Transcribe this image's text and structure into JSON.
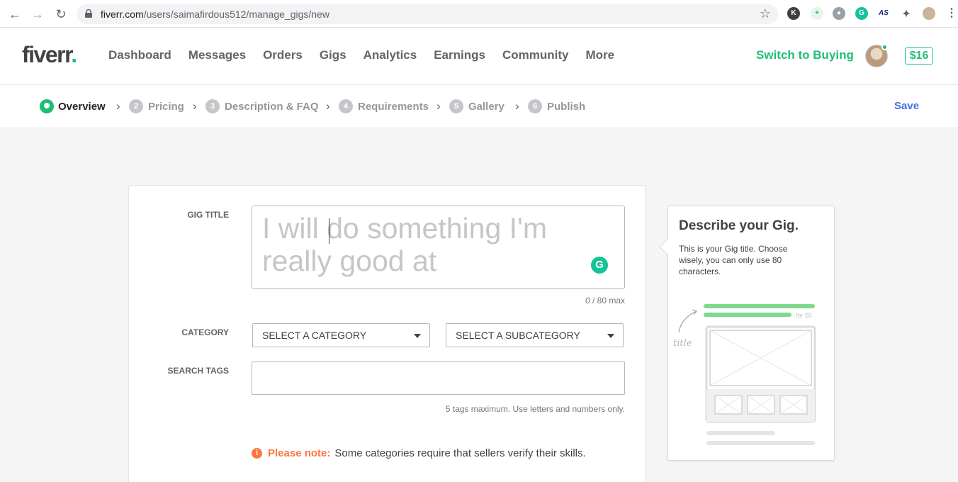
{
  "browser": {
    "url_host": "fiverr.com",
    "url_path": "/users/saimafirdous512/manage_gigs/new"
  },
  "header": {
    "logo": "fiverr",
    "logo_dot": ".",
    "nav": [
      "Dashboard",
      "Messages",
      "Orders",
      "Gigs",
      "Analytics",
      "Earnings",
      "Community",
      "More"
    ],
    "switch_label": "Switch to Buying",
    "balance": "$16"
  },
  "steps": {
    "items": [
      {
        "num": "",
        "label": "Overview"
      },
      {
        "num": "2",
        "label": "Pricing"
      },
      {
        "num": "3",
        "label": "Description & FAQ"
      },
      {
        "num": "4",
        "label": "Requirements"
      },
      {
        "num": "5",
        "label": "Gallery"
      },
      {
        "num": "6",
        "label": "Publish"
      }
    ],
    "save_label": "Save"
  },
  "form": {
    "gig_title_label": "GIG TITLE",
    "gig_title_placeholder": "I will do something I'm really good at",
    "gig_title_value": "",
    "counter_current": "0",
    "counter_rest": " / 80 max",
    "category_label": "CATEGORY",
    "category_select": "SELECT A CATEGORY",
    "subcategory_select": "SELECT A SUBCATEGORY",
    "tags_label": "SEARCH TAGS",
    "tags_value": "",
    "tags_hint": "5 tags maximum. Use letters and numbers only.",
    "note_strong": "Please note:",
    "note_text": "Some categories require that sellers verify their skills."
  },
  "tip": {
    "title": "Describe your Gig.",
    "text": "This is your Gig title. Choose wisely, you can only use 80 characters.",
    "illus_title_word": "title",
    "illus_price_text": "for $5"
  },
  "colors": {
    "brand_green": "#1dbf73",
    "link_blue": "#446ee7",
    "note_orange": "#ff7640"
  }
}
